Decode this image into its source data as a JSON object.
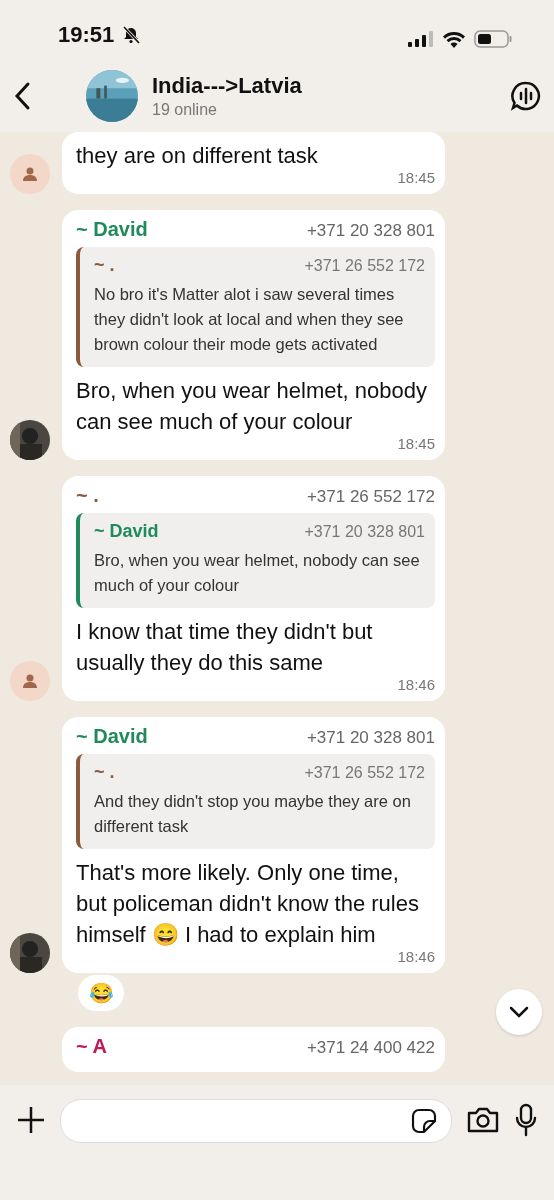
{
  "status_bar": {
    "time": "19:51"
  },
  "header": {
    "title": "India--->Latvia",
    "subtitle": "19 online"
  },
  "messages": [
    {
      "avatar": {
        "kind": "placeholder"
      },
      "text": "they are on different task",
      "time": "18:45"
    },
    {
      "sender": "~ David",
      "color": "#1f8a5a",
      "phone": "+371 20 328 801",
      "quote": {
        "sender": "~ .",
        "color": "#8a5a3c",
        "phone": "+371 26 552 172",
        "text": "No bro it's Matter alot i saw several times they didn't look at local and when they see brown colour their mode gets activated"
      },
      "text": "Bro, when you wear helmet, nobody can see much of your colour",
      "time": "18:45"
    },
    {
      "avatar": {
        "kind": "placeholder"
      },
      "sender": "~ .",
      "color": "#8a5a3c",
      "phone": "+371 26 552 172",
      "quote": {
        "sender": "~ David",
        "color": "#1f8a5a",
        "phone": "+371 20 328 801",
        "text": "Bro, when you wear helmet, nobody can see much of your colour"
      },
      "text": "I know that time they didn't but usually they do this same",
      "time": "18:46"
    },
    {
      "sender": "~ David",
      "color": "#1f8a5a",
      "phone": "+371 20 328 801",
      "quote": {
        "sender": "~ .",
        "color": "#8a5a3c",
        "phone": "+371 26 552 172",
        "text": "And they didn't stop you maybe they are on different task"
      },
      "text": "That's more likely. Only one time, but policeman didn't know the rules himself 😄 I had to explain him",
      "time": "18:46",
      "reaction": "😂"
    },
    {
      "sender": "~ A",
      "color": "#c2185b",
      "phone": "+371 24 400 422"
    }
  ]
}
